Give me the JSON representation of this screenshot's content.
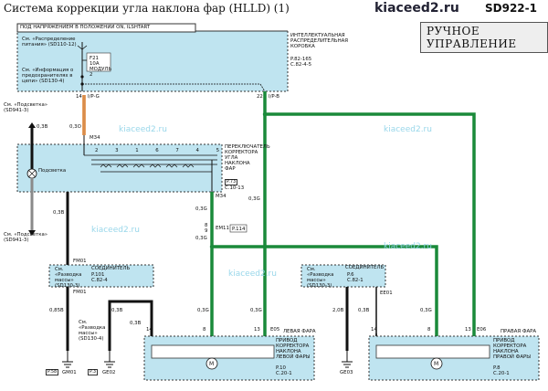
{
  "header": {
    "title": "Система коррекции угла наклона фар (HLLD) (1)",
    "brand": "kiaceed2.ru",
    "page_code": "SD922-1",
    "mode_label": "РУЧНОЕ УПРАВЛЕНИЕ",
    "power_note": "ПОД НАПРЯЖЕНИЕМ В ПОЛОЖЕНИИ ON, ILSHTART"
  },
  "colors": {
    "box_fill": "#bfe4f0",
    "green_wire": "#1a8a3a",
    "orange_wire": "#e8a060",
    "black_wire": "#111111",
    "watermark": "#8fd3e8"
  },
  "watermark": "kiaceed2.ru",
  "smart_box": {
    "see_power": "См. «Распределение питания» (SD110-12)",
    "see_info": "См. «Информация о предохранителях в цепи» (SD130-4)",
    "fuse_label": "F21 10A МОДУЛЬ 2",
    "name": "ИНТЕЛЛЕКТУАЛЬНАЯ РАСПРЕДЕЛИТЕЛЬНАЯ КОРОБКА",
    "ref1": "P.82-165",
    "ref2": "C.82-4-5",
    "pin_left": "14",
    "conn_left": "I/P-G",
    "pin_right": "22",
    "conn_right": "I/P-B"
  },
  "switch": {
    "see_backlight_top": "См. «Подсветка» (SD941-3)",
    "see_backlight_bottom": "См. «Подсветка» (SD941-3)",
    "backlight_label": "Подсветка",
    "name": "ПЕРЕКЛЮЧАТЕЛЬ КОРРЕКТОРА УГЛА НАКЛОНА ФАР",
    "ref1": "P.73",
    "ref2": "C.10-13",
    "conn_top": "M34",
    "conn_bottom": "M34",
    "pins_top": [
      "2",
      "3",
      "1",
      "6",
      "7",
      "4",
      "5"
    ]
  },
  "wires": {
    "orange": "0,3O",
    "black_left_top": "0,3B",
    "black_switch_bottom": "0,3B",
    "green_a": "0,3G",
    "green_b": "0,3G",
    "green_c": "0,3G",
    "green_d": "0,3G",
    "green_e": "0,3G",
    "green_f": "0,3G",
    "gm_b1": "0,85B",
    "gm_b2": "0,3B",
    "gm_b3": "0,3B",
    "right_b": "2,0B",
    "right_b2": "0,3B",
    "pin8": "8",
    "pin9": "9"
  },
  "em11": {
    "label": "EM11",
    "ref": "P.114"
  },
  "connector_left": {
    "title": "СОЕДИНИТЕЛЬ",
    "see": "См. «Разводка массы» (SD130-3)",
    "ref1": "P.101",
    "ref2": "C.82-4",
    "top": "FM01",
    "bottom": "FM01"
  },
  "connector_right": {
    "title": "СОЕДИНИТЕЛЬ",
    "see": "См. «Разводка массы» (SD130-3)",
    "ref1": "P.6",
    "ref2": "C.82-1",
    "bottom": "EE01"
  },
  "see_ground_mid": "См. «Разводка массы» (SD130-4)",
  "left_lamp": {
    "title": "ЛЕВАЯ ФАРА",
    "name": "ПРИВОД КОРРЕКТОРА НАКЛОНА ЛЕВОЙ ФАРЫ",
    "ref1": "P.10",
    "ref2": "C.20-1",
    "conn": "E05",
    "pins": [
      "14",
      "8",
      "13"
    ]
  },
  "right_lamp": {
    "title": "ПРАВАЯ ФАРА",
    "name": "ПРИВОД КОРРЕКТОРА НАКЛОНА ПРАВОЙ ФАРЫ",
    "ref1": "P.8",
    "ref2": "C.20-1",
    "conn": "E06",
    "pins": [
      "14",
      "8",
      "13"
    ]
  },
  "grounds": {
    "g1_ref": "P.58",
    "g1": "GM01",
    "g2_ref": "P.3",
    "g2": "GE02",
    "g3": "GE03"
  }
}
